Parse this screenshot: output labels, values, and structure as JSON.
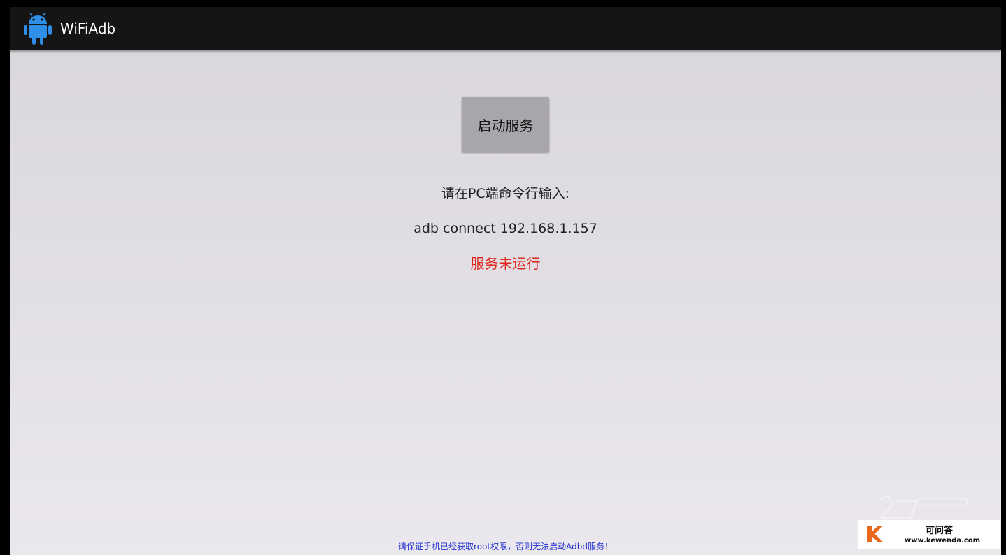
{
  "app": {
    "title": "WiFiAdb",
    "icon": "android-robot-icon",
    "icon_color": "#2f8fe8"
  },
  "main": {
    "start_button_label": "启动服务",
    "prompt_text": "请在PC端命令行输入:",
    "command_text": "adb connect 192.168.1.157",
    "status_text": "服务未运行",
    "status_color": "#e0241b",
    "notice_text": "请保证手机已经获取root权限，否则无法启动Adbd服务！",
    "notice_color": "#1f2fd0"
  },
  "watermark": {
    "logo_letter": "K",
    "site_name": "可问答",
    "site_url": "www.kewenda.com"
  }
}
